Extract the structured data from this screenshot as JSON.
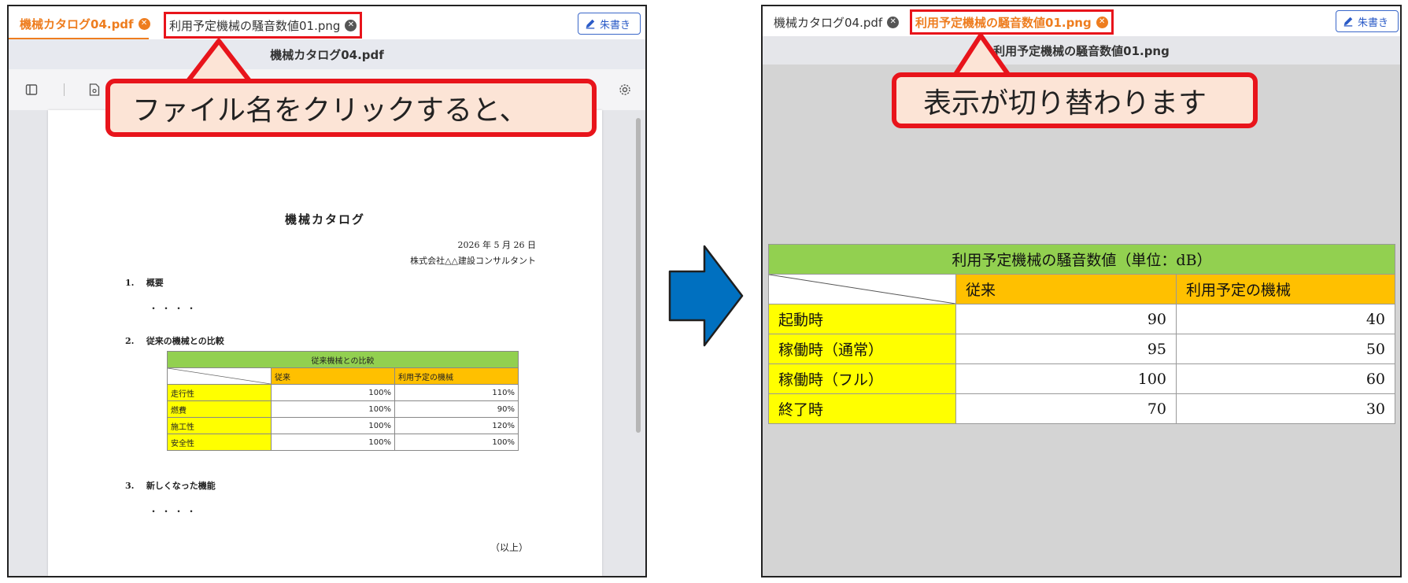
{
  "colors": {
    "tab_active": "#ee7d1f",
    "callout_border": "#e8141b",
    "callout_fill": "#fce4d6",
    "arrow": "#0070c0",
    "table_head": "#92d050",
    "table_col": "#ffc000",
    "table_row": "#ffff00"
  },
  "left": {
    "tabs": [
      {
        "label": "機械カタログ04.pdf",
        "close_icon": "close-circle-icon"
      },
      {
        "label": "利用予定機械の騒音数値01.png",
        "close_icon": "close-circle-icon"
      }
    ],
    "edit_button": "朱書き",
    "title": "機械カタログ04.pdf",
    "toolbar_icons": [
      "sidebar-toggle-icon",
      "document-settings-icon",
      "gear-icon"
    ],
    "document": {
      "title": "機械カタログ",
      "date": "2026 年 5 月 26 日",
      "company": "株式会社△△建設コンサルタント",
      "sections": [
        {
          "number": "1.",
          "heading": "概要",
          "body": "・・・・"
        },
        {
          "number": "2.",
          "heading": "従来の機械との比較"
        },
        {
          "number": "3.",
          "heading": "新しくなった機能",
          "body": "・・・・"
        }
      ],
      "end": "（以上）",
      "comparison_table": {
        "title": "従来機械との比較",
        "columns": [
          "従来",
          "利用予定の機械"
        ],
        "rows": [
          {
            "label": "走行性",
            "values": [
              "100%",
              "110%"
            ]
          },
          {
            "label": "燃費",
            "values": [
              "100%",
              "90%"
            ]
          },
          {
            "label": "施工性",
            "values": [
              "100%",
              "120%"
            ]
          },
          {
            "label": "安全性",
            "values": [
              "100%",
              "100%"
            ]
          }
        ]
      }
    },
    "callout": "ファイル名をクリックすると、"
  },
  "right": {
    "tabs": [
      {
        "label": "機械カタログ04.pdf",
        "close_icon": "close-circle-icon"
      },
      {
        "label": "利用予定機械の騒音数値01.png",
        "close_icon": "close-circle-icon"
      }
    ],
    "edit_button": "朱書き",
    "title": "利用予定機械の騒音数値01.png",
    "noise_table": {
      "title": "利用予定機械の騒音数値（単位：dB）",
      "columns": [
        "従来",
        "利用予定の機械"
      ],
      "rows": [
        {
          "label": "起動時",
          "values": [
            "90",
            "40"
          ]
        },
        {
          "label": "稼働時（通常）",
          "values": [
            "95",
            "50"
          ]
        },
        {
          "label": "稼働時（フル）",
          "values": [
            "100",
            "60"
          ]
        },
        {
          "label": "終了時",
          "values": [
            "70",
            "30"
          ]
        }
      ]
    },
    "callout": "表示が切り替わります"
  }
}
